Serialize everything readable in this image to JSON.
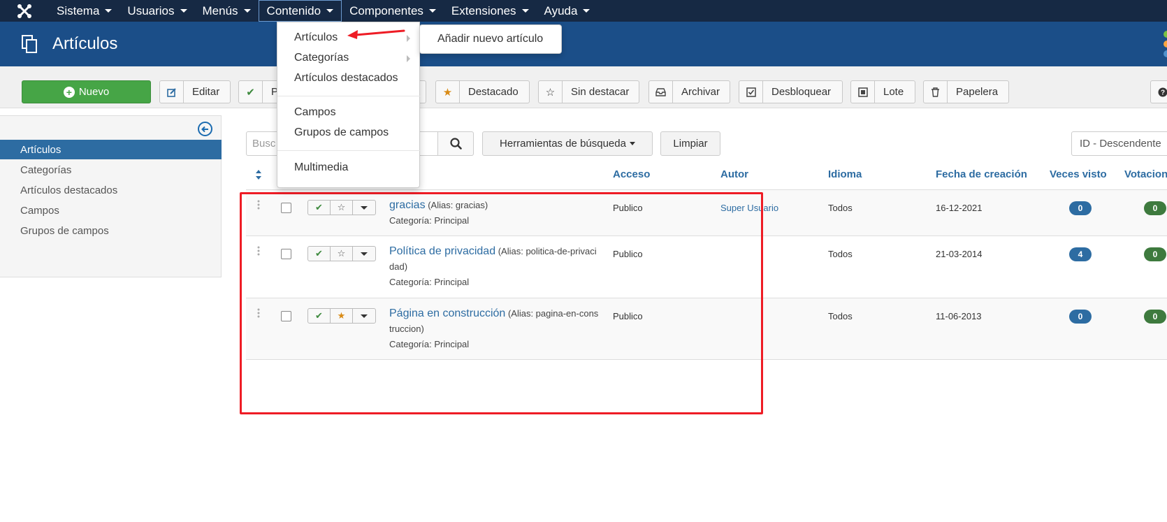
{
  "nav": {
    "items": [
      {
        "label": "Sistema"
      },
      {
        "label": "Usuarios"
      },
      {
        "label": "Menús"
      },
      {
        "label": "Contenido"
      },
      {
        "label": "Componentes"
      },
      {
        "label": "Extensiones"
      },
      {
        "label": "Ayuda"
      }
    ]
  },
  "header": {
    "title": "Artículos"
  },
  "toolbar": {
    "new_label": "Nuevo",
    "edit_label": "Editar",
    "publish_label": "P",
    "featured_label": "Destacado",
    "unfeatured_label": "Sin destacar",
    "archive_label": "Archivar",
    "unlock_label": "Desbloquear",
    "batch_label": "Lote",
    "trash_label": "Papelera"
  },
  "sidebar": {
    "items": [
      {
        "label": "Artículos"
      },
      {
        "label": "Categorías"
      },
      {
        "label": "Artículos destacados"
      },
      {
        "label": "Campos"
      },
      {
        "label": "Grupos de campos"
      }
    ]
  },
  "search": {
    "placeholder": "Busc",
    "tools_label": "Herramientas de búsqueda",
    "clear_label": "Limpiar",
    "ordering_value": "ID - Descendente"
  },
  "table": {
    "headers": {
      "access": "Acceso",
      "author": "Autor",
      "language": "Idioma",
      "created": "Fecha de creación",
      "hits": "Veces visto",
      "votes": "Votacion"
    },
    "rows": [
      {
        "title": "gracias",
        "alias": "(Alias: gracias)",
        "category": "Categoría: Principal",
        "access": "Publico",
        "author": "Super Usuario",
        "language": "Todos",
        "created": "16-12-2021",
        "hits": "0",
        "votes": "0"
      },
      {
        "title": "Política de privacidad",
        "alias": "(Alias: politica-de-privacidad)",
        "category": "Categoría: Principal",
        "access": "Publico",
        "author": "",
        "language": "Todos",
        "created": "21-03-2014",
        "hits": "4",
        "votes": "0"
      },
      {
        "title": "Página en construcción",
        "alias": "(Alias: pagina-en-construccion)",
        "category": "Categoría: Principal",
        "access": "Publico",
        "author": "",
        "language": "Todos",
        "created": "11-06-2013",
        "hits": "0",
        "votes": "0"
      }
    ]
  },
  "dropdown": {
    "items": {
      "articles": "Artículos",
      "categories": "Categorías",
      "featured": "Artículos destacados",
      "fields": "Campos",
      "field_groups": "Grupos de campos",
      "media": "Multimedia"
    },
    "submenu_label": "Añadir nuevo artículo"
  },
  "colors": {
    "nav_bg": "#162944",
    "header_bg": "#1b4e88",
    "success": "#46a546",
    "link": "#2d6ca2",
    "annotation": "#ee1c25"
  }
}
